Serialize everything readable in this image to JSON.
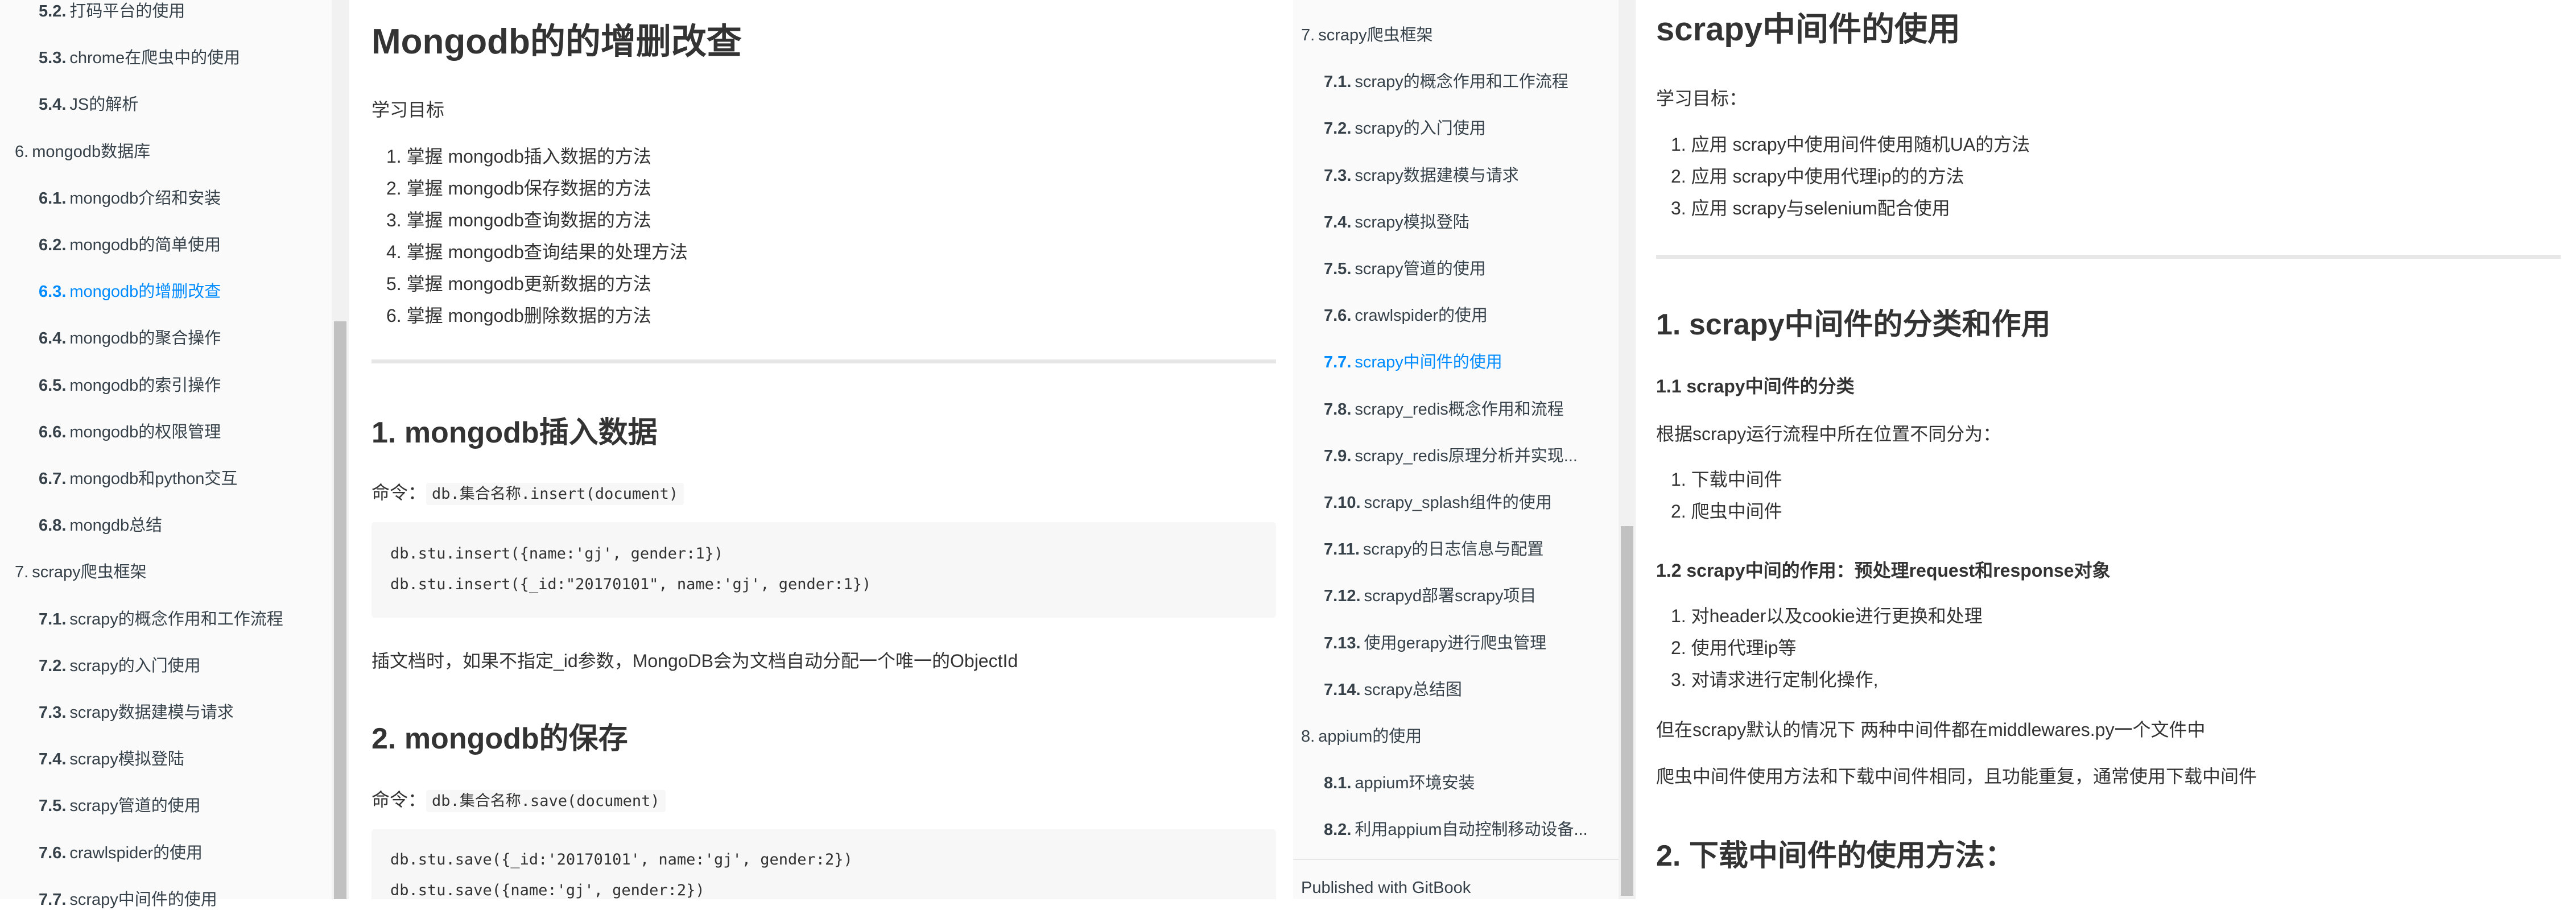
{
  "left_sidebar": {
    "items": [
      {
        "num": "5.2.",
        "label": "打码平台的使用",
        "active": false
      },
      {
        "num": "5.3.",
        "label": "chrome在爬虫中的使用",
        "active": false
      },
      {
        "num": "5.4.",
        "label": "JS的解析",
        "active": false
      },
      {
        "num": "6.",
        "label": "mongodb数据库",
        "active": false
      },
      {
        "num": "6.1.",
        "label": "mongodb介绍和安装",
        "active": false
      },
      {
        "num": "6.2.",
        "label": "mongodb的简单使用",
        "active": false
      },
      {
        "num": "6.3.",
        "label": "mongodb的增删改查",
        "active": true
      },
      {
        "num": "6.4.",
        "label": "mongodb的聚合操作",
        "active": false
      },
      {
        "num": "6.5.",
        "label": "mongodb的索引操作",
        "active": false
      },
      {
        "num": "6.6.",
        "label": "mongodb的权限管理",
        "active": false
      },
      {
        "num": "6.7.",
        "label": "mongodb和python交互",
        "active": false
      },
      {
        "num": "6.8.",
        "label": "mongdb总结",
        "active": false
      },
      {
        "num": "7.",
        "label": "scrapy爬虫框架",
        "active": false
      },
      {
        "num": "7.1.",
        "label": "scrapy的概念作用和工作流程",
        "active": false
      },
      {
        "num": "7.2.",
        "label": "scrapy的入门使用",
        "active": false
      },
      {
        "num": "7.3.",
        "label": "scrapy数据建模与请求",
        "active": false
      },
      {
        "num": "7.4.",
        "label": "scrapy模拟登陆",
        "active": false
      },
      {
        "num": "7.5.",
        "label": "scrapy管道的使用",
        "active": false
      },
      {
        "num": "7.6.",
        "label": "crawlspider的使用",
        "active": false
      },
      {
        "num": "7.7.",
        "label": "scrapy中间件的使用",
        "active": false
      }
    ]
  },
  "mid_content": {
    "title": "Mongodb的的增删改查",
    "goal_label": "学习目标",
    "goals": [
      "掌握 mongodb插入数据的方法",
      "掌握 mongodb保存数据的方法",
      "掌握 mongodb查询数据的方法",
      "掌握 mongodb查询结果的处理方法",
      "掌握 mongodb更新数据的方法",
      "掌握 mongodb删除数据的方法"
    ],
    "section1": {
      "heading": "1. mongodb插入数据",
      "cmd_label": "命令：",
      "cmd_code": "db.集合名称.insert(document)",
      "code_lines": [
        "db.stu.insert({name:'gj', gender:1})",
        "db.stu.insert({_id:\"20170101\", name:'gj', gender:1})"
      ],
      "note": "插文档时，如果不指定_id参数，MongoDB会为文档自动分配一个唯一的ObjectId"
    },
    "section2": {
      "heading": "2. mongodb的保存",
      "cmd_label": "命令：",
      "cmd_code": "db.集合名称.save(document)",
      "code_lines": [
        "db.stu.save({_id:'20170101', name:'gj', gender:2})",
        "db.stu.save({name:'gj', gender:2})"
      ]
    }
  },
  "right_sidebar": {
    "items": [
      {
        "num": "7.",
        "label": "scrapy爬虫框架",
        "active": false,
        "indent": false
      },
      {
        "num": "7.1.",
        "label": "scrapy的概念作用和工作流程",
        "active": false,
        "indent": true
      },
      {
        "num": "7.2.",
        "label": "scrapy的入门使用",
        "active": false,
        "indent": true
      },
      {
        "num": "7.3.",
        "label": "scrapy数据建模与请求",
        "active": false,
        "indent": true
      },
      {
        "num": "7.4.",
        "label": "scrapy模拟登陆",
        "active": false,
        "indent": true
      },
      {
        "num": "7.5.",
        "label": "scrapy管道的使用",
        "active": false,
        "indent": true
      },
      {
        "num": "7.6.",
        "label": "crawlspider的使用",
        "active": false,
        "indent": true
      },
      {
        "num": "7.7.",
        "label": "scrapy中间件的使用",
        "active": true,
        "indent": true
      },
      {
        "num": "7.8.",
        "label": "scrapy_redis概念作用和流程",
        "active": false,
        "indent": true
      },
      {
        "num": "7.9.",
        "label": "scrapy_redis原理分析并实现...",
        "active": false,
        "indent": true
      },
      {
        "num": "7.10.",
        "label": "scrapy_splash组件的使用",
        "active": false,
        "indent": true
      },
      {
        "num": "7.11.",
        "label": "scrapy的日志信息与配置",
        "active": false,
        "indent": true
      },
      {
        "num": "7.12.",
        "label": "scrapyd部署scrapy项目",
        "active": false,
        "indent": true
      },
      {
        "num": "7.13.",
        "label": "使用gerapy进行爬虫管理",
        "active": false,
        "indent": true
      },
      {
        "num": "7.14.",
        "label": "scrapy总结图",
        "active": false,
        "indent": true
      },
      {
        "num": "8.",
        "label": "appium的使用",
        "active": false,
        "indent": false
      },
      {
        "num": "8.1.",
        "label": "appium环境安装",
        "active": false,
        "indent": true
      },
      {
        "num": "8.2.",
        "label": "利用appium自动控制移动设备...",
        "active": false,
        "indent": true
      }
    ],
    "footer": "Published with GitBook"
  },
  "right_content": {
    "title": "scrapy中间件的使用",
    "goal_label": "学习目标：",
    "goals": [
      "应用 scrapy中使用间件使用随机UA的方法",
      "应用 scrapy中使用代理ip的的方法",
      "应用 scrapy与selenium配合使用"
    ],
    "h1": "1. scrapy中间件的分类和作用",
    "h11": "1.1 scrapy中间件的分类",
    "p_classify": "根据scrapy运行流程中所在位置不同分为：",
    "classify_items": [
      "下载中间件",
      "爬虫中间件"
    ],
    "h12_a": "1.2 scrapy中间的作用：预处理",
    "h12_b": "request",
    "h12_c": "和",
    "h12_d": "response",
    "h12_e": "对象",
    "role_items": [
      "对header以及cookie进行更换和处理",
      "使用代理ip等",
      "对请求进行定制化操作,"
    ],
    "p_default": "但在scrapy默认的情况下 两种中间件都在middlewares.py一个文件中",
    "p_same": "爬虫中间件使用方法和下载中间件相同，且功能重复，通常使用下载中间件",
    "h2": "2. 下载中间件的使用方法："
  }
}
